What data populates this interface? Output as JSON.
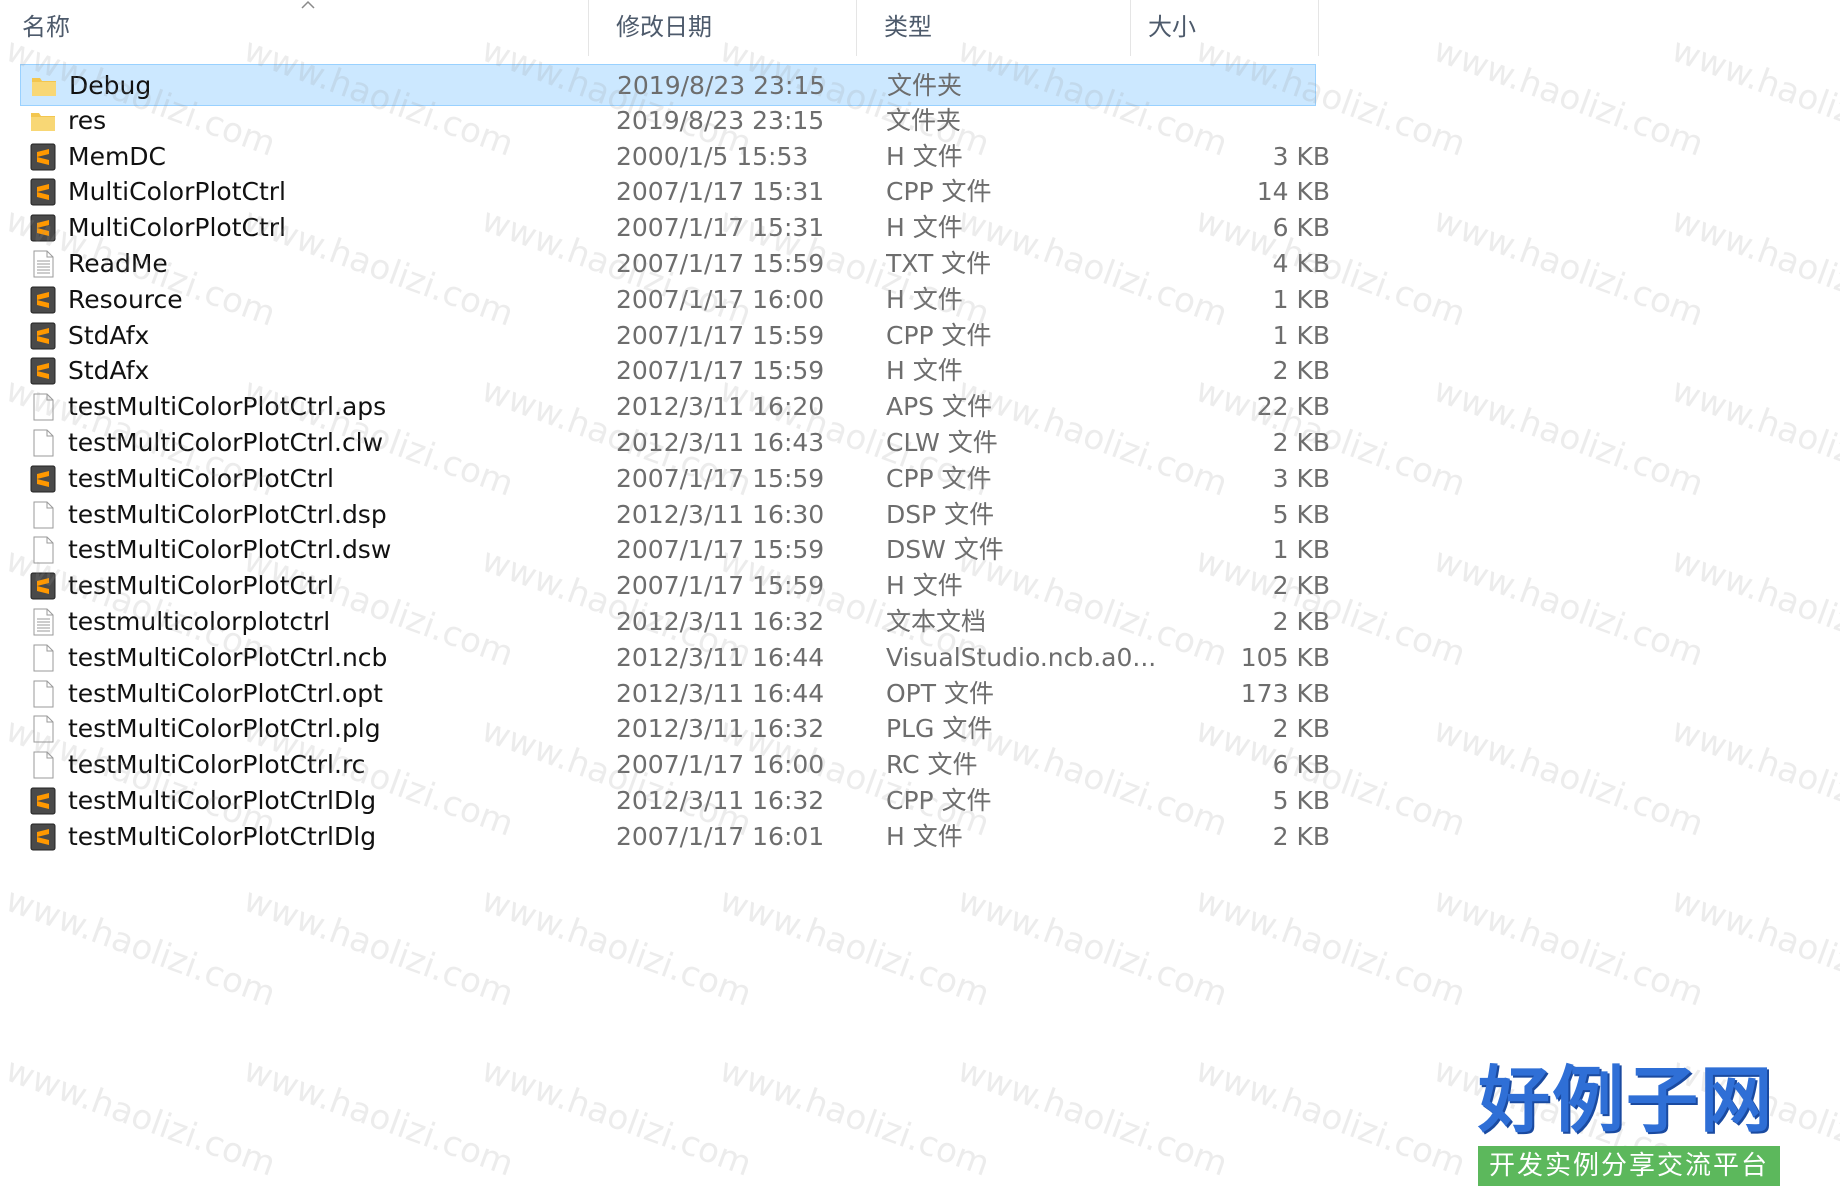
{
  "columns": {
    "name": "名称",
    "date": "修改日期",
    "type": "类型",
    "size": "大小"
  },
  "sort": {
    "column": "name",
    "direction": "ascending"
  },
  "files": [
    {
      "name": "Debug",
      "date": "2019/8/23 23:15",
      "type": "文件夹",
      "size": "",
      "icon": "folder-icon",
      "selected": true
    },
    {
      "name": "res",
      "date": "2019/8/23 23:15",
      "type": "文件夹",
      "size": "",
      "icon": "folder-icon"
    },
    {
      "name": "MemDC",
      "date": "2000/1/5 15:53",
      "type": "H 文件",
      "size": "3 KB",
      "icon": "sublime-file-icon"
    },
    {
      "name": "MultiColorPlotCtrl",
      "date": "2007/1/17 15:31",
      "type": "CPP 文件",
      "size": "14 KB",
      "icon": "sublime-file-icon"
    },
    {
      "name": "MultiColorPlotCtrl",
      "date": "2007/1/17 15:31",
      "type": "H 文件",
      "size": "6 KB",
      "icon": "sublime-file-icon"
    },
    {
      "name": "ReadMe",
      "date": "2007/1/17 15:59",
      "type": "TXT 文件",
      "size": "4 KB",
      "icon": "text-file-icon"
    },
    {
      "name": "Resource",
      "date": "2007/1/17 16:00",
      "type": "H 文件",
      "size": "1 KB",
      "icon": "sublime-file-icon"
    },
    {
      "name": "StdAfx",
      "date": "2007/1/17 15:59",
      "type": "CPP 文件",
      "size": "1 KB",
      "icon": "sublime-file-icon"
    },
    {
      "name": "StdAfx",
      "date": "2007/1/17 15:59",
      "type": "H 文件",
      "size": "2 KB",
      "icon": "sublime-file-icon"
    },
    {
      "name": "testMultiColorPlotCtrl.aps",
      "date": "2012/3/11 16:20",
      "type": "APS 文件",
      "size": "22 KB",
      "icon": "blank-file-icon"
    },
    {
      "name": "testMultiColorPlotCtrl.clw",
      "date": "2012/3/11 16:43",
      "type": "CLW 文件",
      "size": "2 KB",
      "icon": "blank-file-icon"
    },
    {
      "name": "testMultiColorPlotCtrl",
      "date": "2007/1/17 15:59",
      "type": "CPP 文件",
      "size": "3 KB",
      "icon": "sublime-file-icon"
    },
    {
      "name": "testMultiColorPlotCtrl.dsp",
      "date": "2012/3/11 16:30",
      "type": "DSP 文件",
      "size": "5 KB",
      "icon": "blank-file-icon"
    },
    {
      "name": "testMultiColorPlotCtrl.dsw",
      "date": "2007/1/17 15:59",
      "type": "DSW 文件",
      "size": "1 KB",
      "icon": "blank-file-icon"
    },
    {
      "name": "testMultiColorPlotCtrl",
      "date": "2007/1/17 15:59",
      "type": "H 文件",
      "size": "2 KB",
      "icon": "sublime-file-icon"
    },
    {
      "name": "testmulticolorplotctrl",
      "date": "2012/3/11 16:32",
      "type": "文本文档",
      "size": "2 KB",
      "icon": "text-file-icon"
    },
    {
      "name": "testMultiColorPlotCtrl.ncb",
      "date": "2012/3/11 16:44",
      "type": "VisualStudio.ncb.a0...",
      "size": "105 KB",
      "icon": "blank-file-icon"
    },
    {
      "name": "testMultiColorPlotCtrl.opt",
      "date": "2012/3/11 16:44",
      "type": "OPT 文件",
      "size": "173 KB",
      "icon": "blank-file-icon"
    },
    {
      "name": "testMultiColorPlotCtrl.plg",
      "date": "2012/3/11 16:32",
      "type": "PLG 文件",
      "size": "2 KB",
      "icon": "blank-file-icon"
    },
    {
      "name": "testMultiColorPlotCtrl.rc",
      "date": "2007/1/17 16:00",
      "type": "RC 文件",
      "size": "6 KB",
      "icon": "blank-file-icon"
    },
    {
      "name": "testMultiColorPlotCtrlDlg",
      "date": "2012/3/11 16:32",
      "type": "CPP 文件",
      "size": "5 KB",
      "icon": "sublime-file-icon"
    },
    {
      "name": "testMultiColorPlotCtrlDlg",
      "date": "2007/1/17 16:01",
      "type": "H 文件",
      "size": "2 KB",
      "icon": "sublime-file-icon"
    }
  ],
  "watermark": "www.haolizi.com",
  "logo": {
    "title": "好例子网",
    "subtitle": "开发实例分享交流平台"
  },
  "colors": {
    "selection": "#cce8ff",
    "selection_border": "#99d1ff",
    "folder": "#f3c64f",
    "header_text": "#4d5a6b",
    "logo_blue": "#2f6fd6",
    "logo_green": "#5cb85c"
  }
}
